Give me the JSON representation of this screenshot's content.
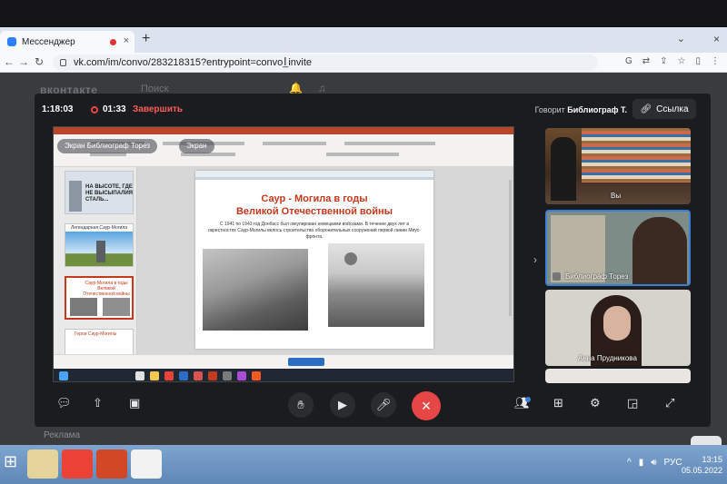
{
  "browser": {
    "tab_title": "Мессенджер",
    "tab_close": "×",
    "new_tab": "+",
    "url": "vk.com/im/convo/283218315?entrypoint=convo_invite"
  },
  "vk": {
    "logo": "вконтакте",
    "search": "Поиск",
    "ad": "Реклама"
  },
  "call": {
    "duration": "1:18:03",
    "recording_time": "01:33",
    "stop_recording": "Завершить",
    "speaking_prefix": "Говорит",
    "speaking_name": "Библиограф Т.",
    "link_label": "Ссылка"
  },
  "share": {
    "screen_label": "Экран Библиограф Торез",
    "screen_label_2": "Экран",
    "slide": {
      "title_line1": "Саур - Могила в годы",
      "title_line2": "Великой Отечественной войны",
      "body": "С 1941 по 1943 год Донбасс был оккупирован немецкими войсками. В течение двух лет в окрестностях Саур-Могилы велось строительство оборонительных сооружений первой линии Миус-фронта."
    },
    "thumbs": [
      {
        "text": "НА ВЫСОТЕ, ГДЕ НЕ ВЫСЫПАЛИЯ СТАЛЬ..."
      },
      {
        "text": "Легендарная Саур-Могила"
      },
      {
        "text": "Саур-Могила в годы Великой Отечественной войны"
      },
      {
        "text": "Герои Саур-Могилы"
      }
    ]
  },
  "participants": [
    {
      "name": "Вы"
    },
    {
      "name": "Библиограф Торез"
    },
    {
      "name": "Анна Прудникова"
    }
  ],
  "taskbar": {
    "lang": "РУС",
    "time": "13:15",
    "date": "05.05.2022"
  }
}
